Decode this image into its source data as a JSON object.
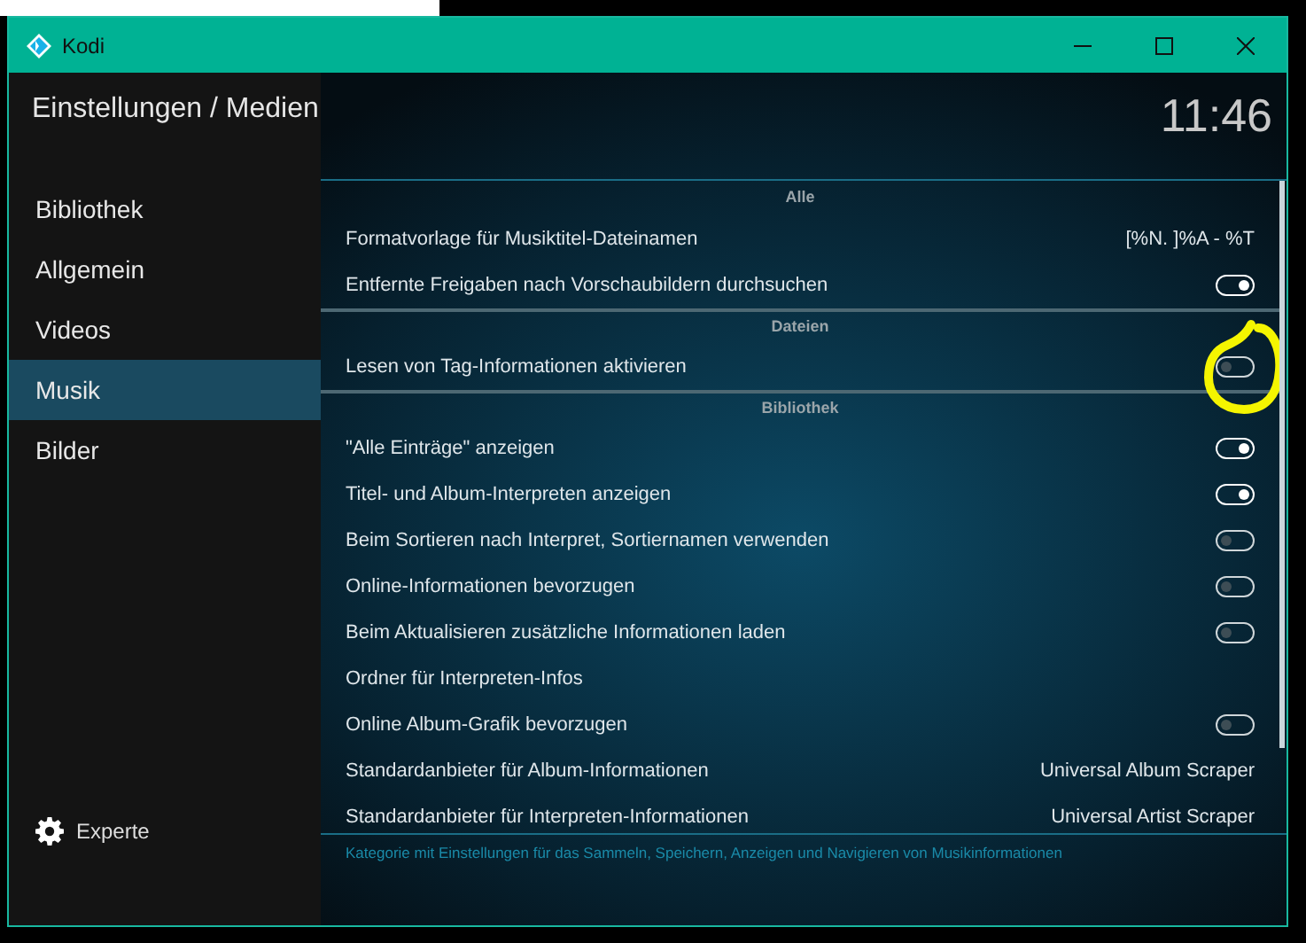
{
  "window": {
    "title": "Kodi"
  },
  "header": {
    "title": "Einstellungen / Medien",
    "time": "11:46"
  },
  "sidebar": {
    "items": [
      {
        "label": "Bibliothek",
        "selected": false
      },
      {
        "label": "Allgemein",
        "selected": false
      },
      {
        "label": "Videos",
        "selected": false
      },
      {
        "label": "Musik",
        "selected": true
      },
      {
        "label": "Bilder",
        "selected": false
      }
    ],
    "level_button": "Experte"
  },
  "settings": [
    {
      "kind": "header",
      "label": "Alle"
    },
    {
      "kind": "value",
      "label": "Formatvorlage für Musiktitel-Dateinamen",
      "value": "[%N. ]%A - %T"
    },
    {
      "kind": "toggle",
      "label": "Entfernte Freigaben nach Vorschaubildern durchsuchen",
      "on": true,
      "circled": false
    },
    {
      "kind": "header",
      "label": "Dateien"
    },
    {
      "kind": "toggle",
      "label": "Lesen von Tag-Informationen aktivieren",
      "on": false,
      "circled": true
    },
    {
      "kind": "header",
      "label": "Bibliothek"
    },
    {
      "kind": "toggle",
      "label": "\"Alle Einträge\" anzeigen",
      "on": true,
      "circled": false
    },
    {
      "kind": "toggle",
      "label": "Titel- und Album-Interpreten anzeigen",
      "on": true,
      "circled": false
    },
    {
      "kind": "toggle",
      "label": "Beim Sortieren nach Interpret, Sortiernamen verwenden",
      "on": false,
      "circled": false
    },
    {
      "kind": "toggle",
      "label": "Online-Informationen bevorzugen",
      "on": false,
      "circled": false
    },
    {
      "kind": "toggle",
      "label": "Beim Aktualisieren zusätzliche Informationen laden",
      "on": false,
      "circled": false
    },
    {
      "kind": "action",
      "label": "Ordner für Interpreten-Infos"
    },
    {
      "kind": "toggle",
      "label": "Online Album-Grafik bevorzugen",
      "on": false,
      "circled": false
    },
    {
      "kind": "value",
      "label": "Standardanbieter für Album-Informationen",
      "value": "Universal Album Scraper"
    },
    {
      "kind": "value",
      "label": "Standardanbieter für Interpreten-Informationen",
      "value": "Universal Artist Scraper"
    }
  ],
  "description": "Kategorie mit Einstellungen für das Sammeln, Speichern, Anzeigen und Navigieren von Musikinformationen"
}
